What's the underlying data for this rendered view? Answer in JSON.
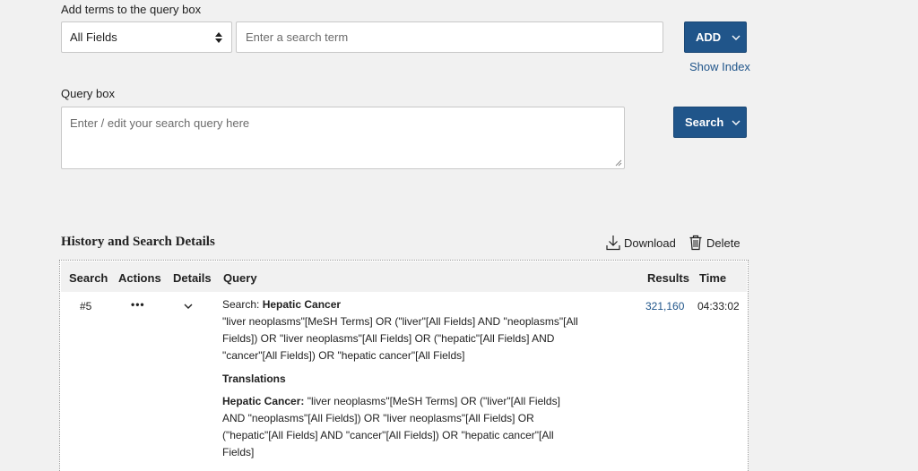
{
  "add_terms": {
    "heading": "Add terms to the query box",
    "field_select": "All Fields",
    "term_placeholder": "Enter a search term",
    "add_label": "ADD",
    "show_index": "Show Index"
  },
  "query_box": {
    "heading": "Query box",
    "placeholder": "Enter / edit your search query here",
    "search_label": "Search"
  },
  "history": {
    "title": "History and Search Details",
    "download_label": "Download",
    "delete_label": "Delete",
    "columns": [
      "Search",
      "Actions",
      "Details",
      "Query",
      "Results",
      "Time"
    ],
    "rows": [
      {
        "search": "#5",
        "actions": "•••",
        "search_prefix": "Search:",
        "search_term": "Hepatic Cancer",
        "query_lines": [
          "\"liver neoplasms\"[MeSH Terms] OR (\"liver\"[All Fields] AND \"neoplasms\"[All",
          "Fields]) OR \"liver neoplasms\"[All Fields] OR (\"hepatic\"[All Fields] AND",
          "\"cancer\"[All Fields]) OR \"hepatic cancer\"[All Fields]"
        ],
        "translations_heading": "Translations",
        "translation_term": "Hepatic Cancer:",
        "translation_lines": [
          " \"liver neoplasms\"[MeSH Terms] OR (\"liver\"[All Fields]",
          "AND \"neoplasms\"[All Fields]) OR \"liver neoplasms\"[All Fields] OR",
          "(\"hepatic\"[All Fields] AND \"cancer\"[All Fields]) OR \"hepatic cancer\"[All",
          "Fields]"
        ],
        "results": "321,160",
        "time": "04:33:02"
      }
    ]
  },
  "colors": {
    "primary_button": "#20558a",
    "link": "#20558a",
    "background": "#f1f1f1"
  },
  "icons": [
    "select-arrows-icon",
    "chevron-down-icon",
    "download-icon",
    "trash-icon",
    "resize-grip-icon"
  ]
}
